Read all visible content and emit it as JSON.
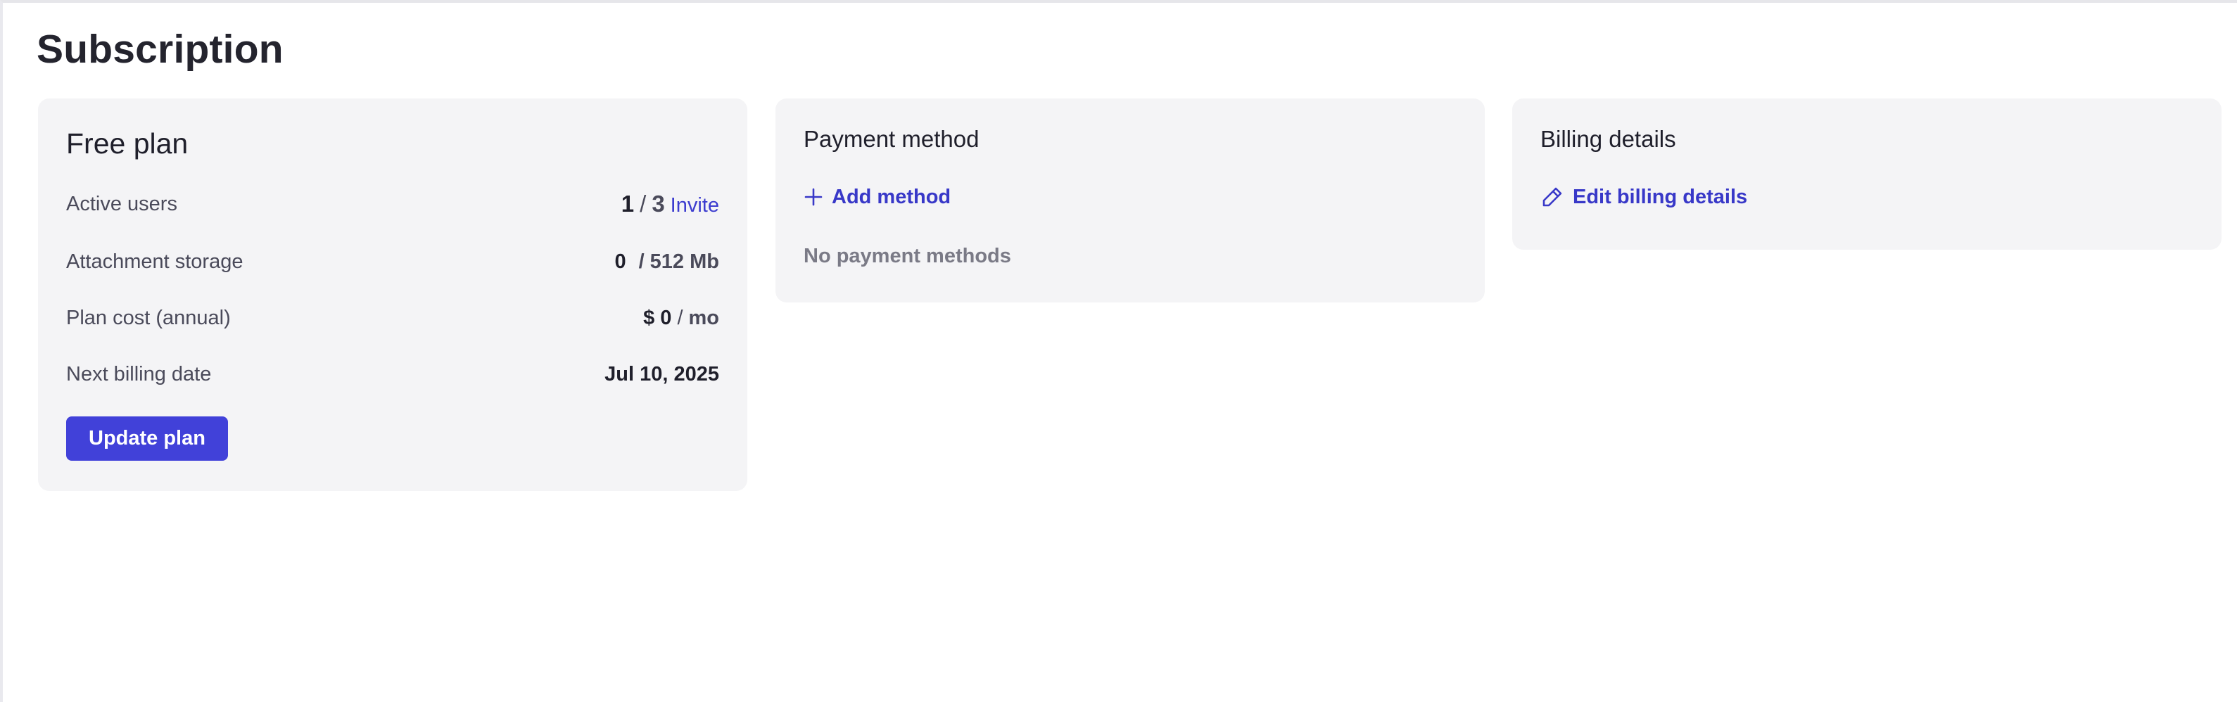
{
  "page": {
    "title": "Subscription"
  },
  "plan_card": {
    "title": "Free plan",
    "rows": {
      "active_users": {
        "label": "Active users",
        "current": "1",
        "separator": "/",
        "limit": "3",
        "action": "Invite"
      },
      "attachment_storage": {
        "label": "Attachment storage",
        "used": "0",
        "separator": "/",
        "limit": "512 Mb"
      },
      "plan_cost": {
        "label": "Plan cost (annual)",
        "amount": "$ 0",
        "separator": "/",
        "period": "mo"
      },
      "next_billing": {
        "label": "Next billing date",
        "date": "Jul 10, 2025"
      }
    },
    "update_button": "Update plan"
  },
  "payment_card": {
    "title": "Payment method",
    "add_label": "Add method",
    "add_icon": "plus-icon",
    "empty_text": "No payment methods"
  },
  "billing_card": {
    "title": "Billing details",
    "edit_label": "Edit billing details",
    "edit_icon": "pencil-icon"
  },
  "colors": {
    "accent": "#4141d9",
    "link": "#3838c8",
    "card_bg": "#f4f4f6",
    "text_primary": "#1f1f2b",
    "text_secondary": "#4a4a5a",
    "text_muted": "#7a7a86"
  }
}
